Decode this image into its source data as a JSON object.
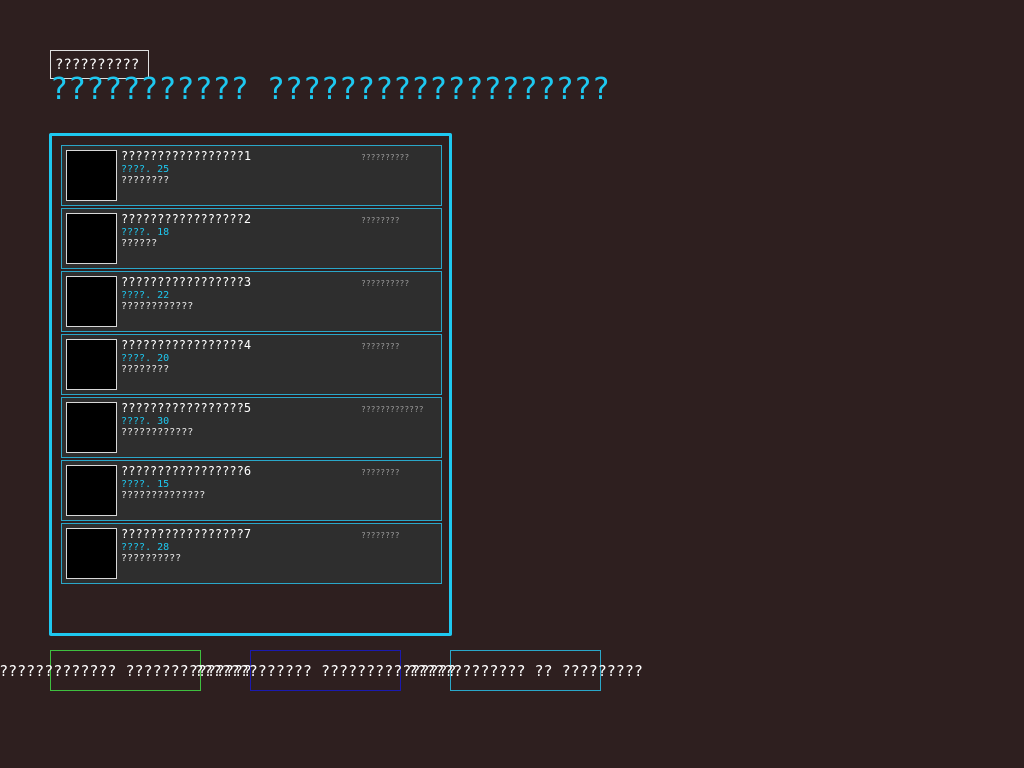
{
  "header": {
    "label": "??????????",
    "title": "??????????? ???????????????????"
  },
  "list": {
    "items": [
      {
        "title": "?????????????????1",
        "meta": "????. 25",
        "desc": "????????",
        "date": "??????????"
      },
      {
        "title": "?????????????????2",
        "meta": "????. 18",
        "desc": "??????",
        "date": "????????"
      },
      {
        "title": "?????????????????3",
        "meta": "????. 22",
        "desc": "????????????",
        "date": "??????????"
      },
      {
        "title": "?????????????????4",
        "meta": "????. 20",
        "desc": "????????",
        "date": "????????"
      },
      {
        "title": "?????????????????5",
        "meta": "????. 30",
        "desc": "????????????",
        "date": "?????????????"
      },
      {
        "title": "?????????????????6",
        "meta": "????. 15",
        "desc": "??????????????",
        "date": "????????"
      },
      {
        "title": "?????????????????7",
        "meta": "????. 28",
        "desc": "??????????",
        "date": "????????"
      }
    ]
  },
  "actions": {
    "button1": "????????????? ??????????????",
    "button2": "????????????? ???????????????",
    "button3": "????????????? ?? ?????????"
  },
  "colors": {
    "background": "#2e1f1f",
    "accent": "#1ec8f0",
    "button1_border": "#3fbf3f",
    "button2_border": "#1a1ab0",
    "button3_border": "#2aa7c9"
  }
}
